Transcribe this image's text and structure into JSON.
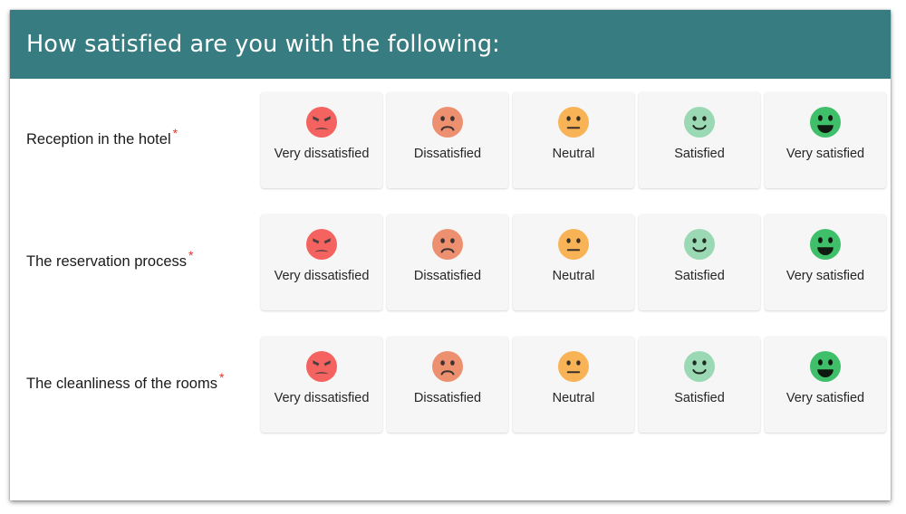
{
  "header": {
    "title": "How satisfied are you with the following:",
    "background_color": "#367c80",
    "text_color": "#ffffff"
  },
  "required_marker": "*",
  "questions": [
    {
      "label": "Reception in the hotel",
      "required": true
    },
    {
      "label": "The reservation process",
      "required": true
    },
    {
      "label": "The cleanliness of the rooms",
      "required": true
    }
  ],
  "options": [
    {
      "label": "Very dissatisfied",
      "icon": "angry-face-icon",
      "face_color": "#f4635f",
      "feature_color": "#4a3f3f"
    },
    {
      "label": "Dissatisfied",
      "icon": "frowning-face-icon",
      "face_color": "#ed9070",
      "feature_color": "#3c3230"
    },
    {
      "label": "Neutral",
      "icon": "neutral-face-icon",
      "face_color": "#f8b357",
      "feature_color": "#3a3027"
    },
    {
      "label": "Satisfied",
      "icon": "smiling-face-icon",
      "face_color": "#9ad9b4",
      "feature_color": "#1f2b23"
    },
    {
      "label": "Very satisfied",
      "icon": "grinning-face-icon",
      "face_color": "#3fbf6a",
      "feature_color": "#10190f"
    }
  ],
  "card_background_color": "#f6f6f6",
  "required_star_color": "#e8352b"
}
